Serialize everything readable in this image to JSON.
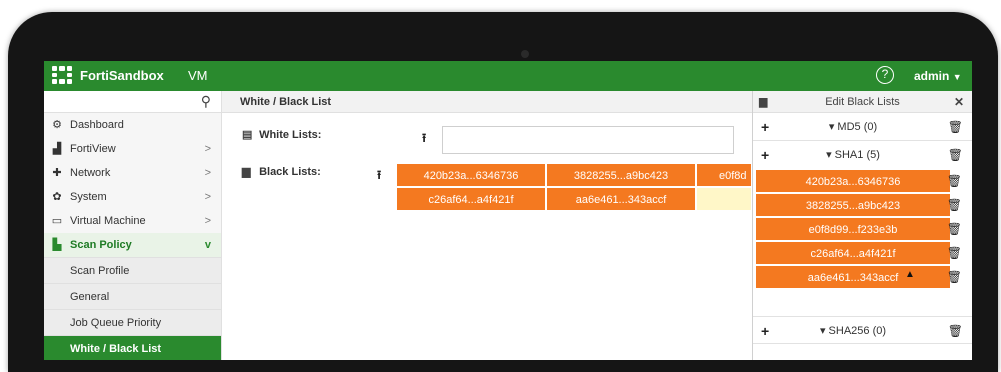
{
  "header": {
    "app_name": "FortiSandbox",
    "app_sub": "VM",
    "help": "?",
    "user": "admin"
  },
  "sidebar": {
    "items": [
      {
        "label": "Dashboard",
        "icon": "dashboard-icon",
        "chevron": ""
      },
      {
        "label": "FortiView",
        "icon": "fortiview-icon",
        "chevron": ">"
      },
      {
        "label": "Network",
        "icon": "network-icon",
        "chevron": ">"
      },
      {
        "label": "System",
        "icon": "gear-icon",
        "chevron": ">"
      },
      {
        "label": "Virtual Machine",
        "icon": "monitor-icon",
        "chevron": ">"
      },
      {
        "label": "Scan Policy",
        "icon": "scan-policy-icon",
        "chevron": "v"
      }
    ],
    "sub_items": [
      {
        "label": "Scan Profile"
      },
      {
        "label": "General"
      },
      {
        "label": "Job Queue Priority"
      },
      {
        "label": "White / Black List"
      }
    ]
  },
  "main": {
    "breadcrumb": "White / Black List",
    "white_label": "White Lists:",
    "black_label": "Black Lists:",
    "black_tags": [
      "420b23a...6346736",
      "3828255...a9bc423",
      "e0f8d",
      "c26af64...a4f421f",
      "aa6e461...343accf"
    ]
  },
  "panel": {
    "title": "Edit Black Lists",
    "groups": [
      {
        "name": "MD5 (0)"
      },
      {
        "name": "SHA1 (5)"
      },
      {
        "name": "SHA256 (0)"
      }
    ],
    "sha1_items": [
      "420b23a...6346736",
      "3828255...a9bc423",
      "e0f8d99...f233e3b",
      "c26af64...a4f421f",
      "aa6e461...343accf"
    ]
  },
  "colors": {
    "brand_green": "#2a8a2e",
    "tag_orange": "#f47920"
  }
}
